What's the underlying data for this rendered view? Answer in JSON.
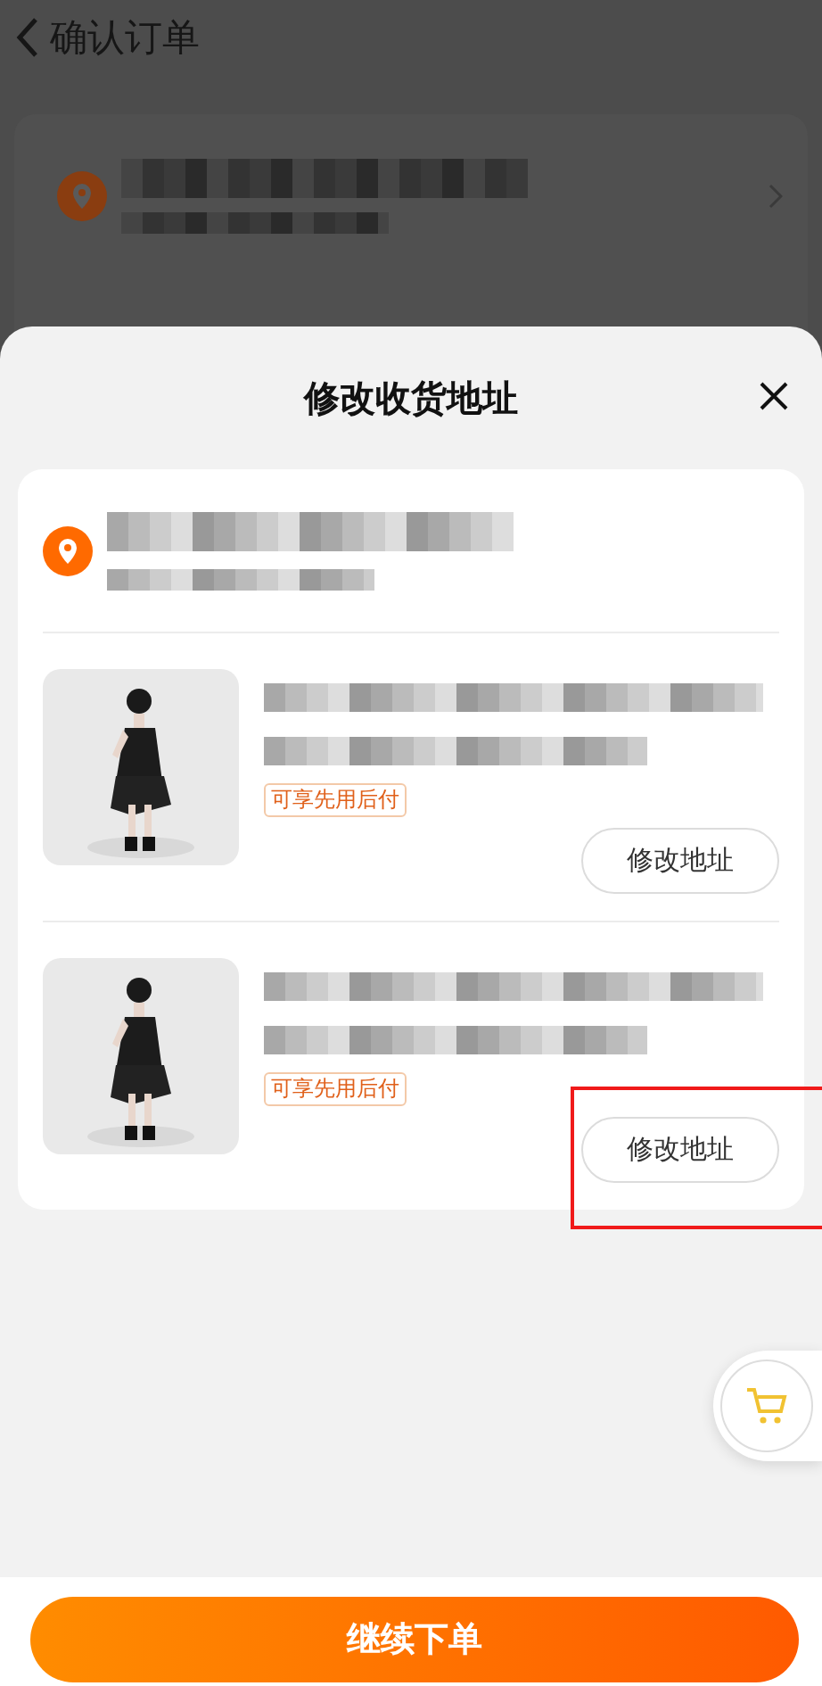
{
  "background_page": {
    "title": "确认订单"
  },
  "sheet": {
    "title": "修改收货地址",
    "items": [
      {
        "tag": "可享先用后付",
        "button": "修改地址",
        "highlighted": false
      },
      {
        "tag": "可享先用后付",
        "button": "修改地址",
        "highlighted": true
      }
    ]
  },
  "submit_button": "继续下单"
}
